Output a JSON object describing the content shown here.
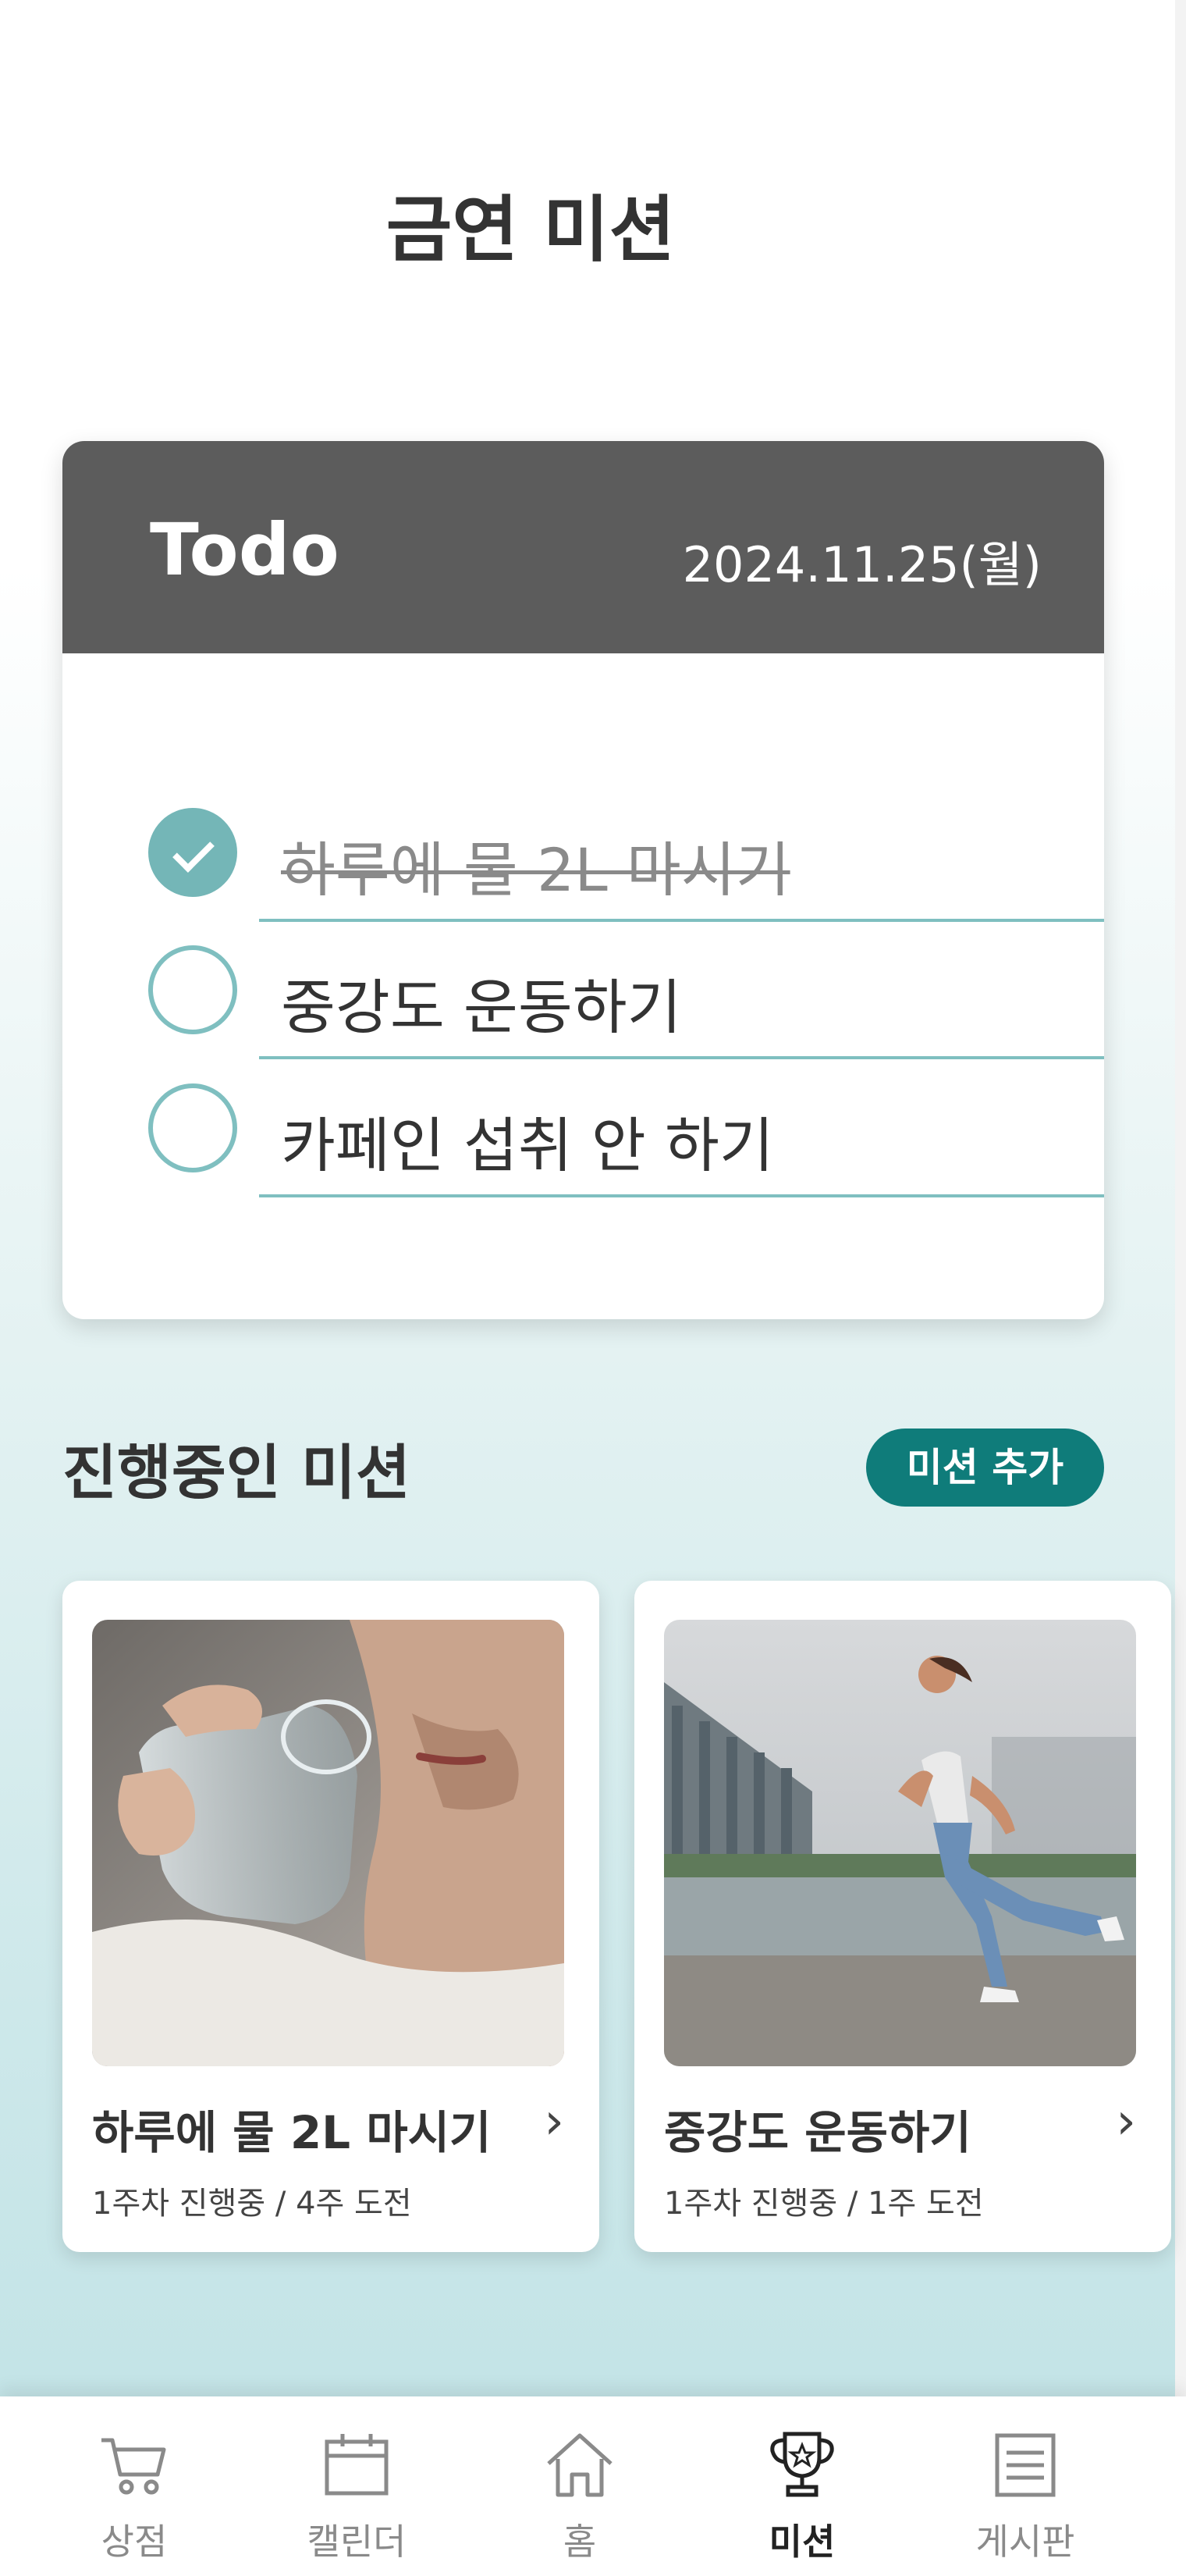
{
  "header": {
    "title": "금연 미션"
  },
  "todo": {
    "title": "Todo",
    "date": "2024.11.25(월)",
    "items": [
      {
        "label": "하루에 물 2L 마시기",
        "done": true
      },
      {
        "label": "중강도 운동하기",
        "done": false
      },
      {
        "label": "카페인 섭취 안 하기",
        "done": false
      }
    ]
  },
  "missions": {
    "section_title": "진행중인 미션",
    "add_button": "미션 추가",
    "cards": [
      {
        "title": "하루에 물 2L 마시기",
        "progress": "1주차 진행중 / 4주 도전"
      },
      {
        "title": "중강도 운동하기",
        "progress": "1주차 진행중 / 1주 도전"
      }
    ]
  },
  "bottom_nav": {
    "items": [
      {
        "label": "상점",
        "icon": "cart-icon"
      },
      {
        "label": "캘린더",
        "icon": "calendar-icon"
      },
      {
        "label": "홈",
        "icon": "home-icon"
      },
      {
        "label": "미션",
        "icon": "trophy-icon"
      },
      {
        "label": "게시판",
        "icon": "board-icon"
      }
    ],
    "active": "미션"
  },
  "colors": {
    "accent": "#0f7c7a",
    "check": "#74b6b7",
    "header_bg": "#5c5c5c"
  }
}
